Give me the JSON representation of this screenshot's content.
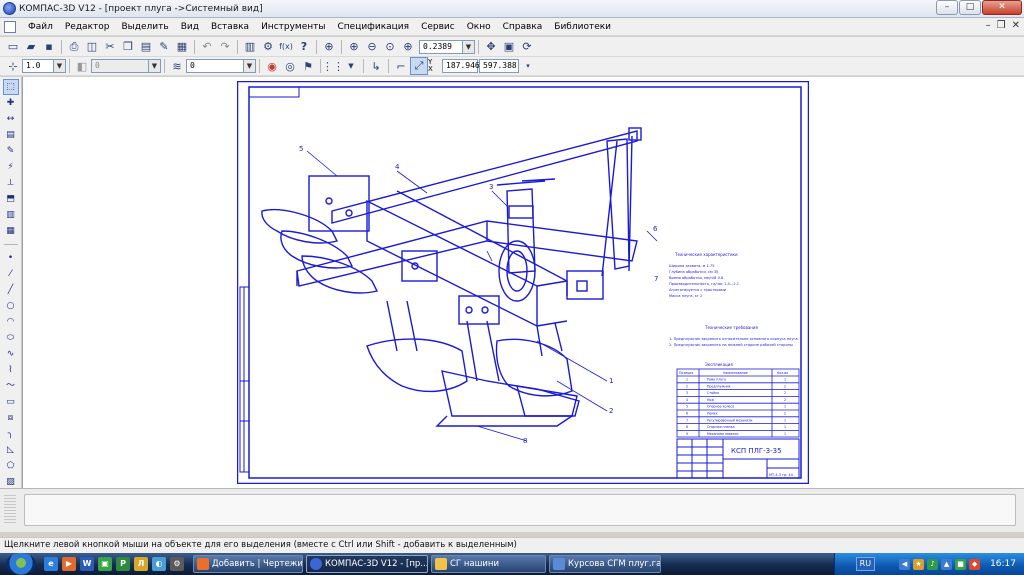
{
  "window": {
    "title": "КОМПАС-3D V12 - [проект плуга ->Системный вид]",
    "controls": {
      "minimize": "–",
      "maximize": "□",
      "close": "✕"
    }
  },
  "menu": {
    "items": [
      "Файл",
      "Редактор",
      "Выделить",
      "Вид",
      "Вставка",
      "Инструменты",
      "Спецификация",
      "Сервис",
      "Окно",
      "Справка",
      "Библиотеки"
    ],
    "mdi_controls": {
      "minimize": "–",
      "restore": "❐",
      "close": "✕"
    }
  },
  "toolbar_top": {
    "zoom_value": "0.2389",
    "icons": [
      "new-icon",
      "open-icon",
      "save-icon",
      "print-icon",
      "print-preview-icon",
      "cut-icon",
      "copy-icon",
      "paste-icon",
      "format-painter-icon",
      "properties-icon",
      "undo-icon",
      "redo-icon",
      "manager-icon",
      "variables-icon",
      "fx-icon",
      "help-icon",
      "zoom-icon",
      "zoom-in-icon",
      "zoom-out-icon",
      "zoom-scale-icon",
      "pan-icon",
      "zoom-window-icon",
      "refresh-icon"
    ],
    "help_glyph": "?",
    "fx_glyph": "f(x)"
  },
  "toolbar_params": {
    "step_value": "1.0",
    "layer_value": "0",
    "style_value": "0",
    "coord_x": "187.946",
    "coord_y": "597.388",
    "xy_label_y": "Y",
    "xy_label_x": "X"
  },
  "drawing": {
    "tech_title": "Технические характеристики",
    "tech_lines": [
      "Ширина захвата, м                  1.75",
      "Глубина обработки, см              35",
      "Время обработки, мм/ч/8            0.8",
      "Производительность, га/час       1.4—2.1",
      "Агрегатируется с тракторами",
      "Масса плуга, кг                      2"
    ],
    "req_title": "Технические требования",
    "req_lines": [
      "1. Предплужник закрепить относительно основного корпуса плуга",
      "2. Предплужник закрепить на нижней стороне рабочей стороны"
    ],
    "expl_title": "Экспликация",
    "table_headers": [
      "Позиция",
      "Наименование",
      "Кол-во"
    ],
    "table_rows": [
      [
        "1",
        "Рама плуга",
        "1"
      ],
      [
        "2",
        "Предплужник",
        "2"
      ],
      [
        "3",
        "Стойка",
        "2"
      ],
      [
        "4",
        "Нож",
        "2"
      ],
      [
        "5",
        "Опорное колесо",
        "1"
      ],
      [
        "6",
        "Лемех",
        "2"
      ],
      [
        "7",
        "Регулировочный механизм",
        "1"
      ],
      [
        "8",
        "Опорная планка",
        "1"
      ],
      [
        "9",
        "Механизм навески",
        "1"
      ]
    ],
    "stamp_code": "КСП ПЛГ-3-35",
    "stamp_sheet": "МТ-4.3 гр. 44",
    "callouts": [
      "5",
      "4",
      "3",
      "6",
      "7",
      "1",
      "2",
      "8"
    ]
  },
  "status": {
    "hint": "Щелкните левой кнопкой мыши на объекте для его выделения (вместе с Ctrl или Shift - добавить к выделенным)"
  },
  "taskbar": {
    "tasks": [
      {
        "label": "Добавить | Чертежи ...",
        "color": "#e8702a"
      },
      {
        "label": "КОМПАС-3D V12 - [пр...",
        "color": "#3a66d6"
      },
      {
        "label": "СГ нашини",
        "color": "#f2c34a"
      },
      {
        "label": "Курсова СГМ плуг.га...",
        "color": "#5a8bd6"
      }
    ],
    "quicklaunch": [
      {
        "glyph": "e",
        "color": "#2b7de0"
      },
      {
        "glyph": "▶",
        "color": "#e06a2b"
      },
      {
        "glyph": "W",
        "color": "#2b5bb8"
      },
      {
        "glyph": "▣",
        "color": "#3aa34a"
      },
      {
        "glyph": "Р",
        "color": "#2e8b3e"
      },
      {
        "glyph": "Л",
        "color": "#d8a72a"
      },
      {
        "glyph": "◐",
        "color": "#4a9ed8"
      },
      {
        "glyph": "⚙",
        "color": "#5a5a5a"
      }
    ],
    "language": "RU",
    "tray_icons": [
      {
        "glyph": "◀",
        "color": "#3b7bd0"
      },
      {
        "glyph": "★",
        "color": "#d8a02a"
      },
      {
        "glyph": "♪",
        "color": "#2b9a4a"
      },
      {
        "glyph": "▲",
        "color": "#3b7bd0"
      },
      {
        "glyph": "■",
        "color": "#3aa34a"
      },
      {
        "glyph": "◆",
        "color": "#d84a2a"
      }
    ],
    "clock": "16:17"
  },
  "colors": {
    "drawing_line": "#1a1ad8",
    "canvas": "#ffffff",
    "chrome": "#f0f0f0"
  }
}
